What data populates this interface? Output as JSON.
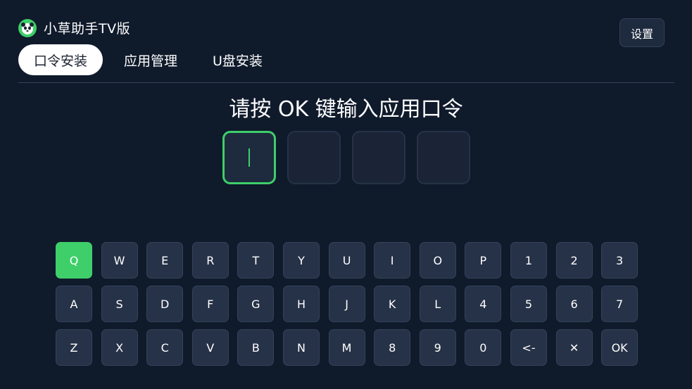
{
  "app": {
    "title": "小草助手TV版",
    "logo_icon": "panda-logo-icon",
    "accent_color": "#3ecf6a"
  },
  "header": {
    "settings_label": "设置"
  },
  "tabs": [
    {
      "label": "口令安装",
      "active": true
    },
    {
      "label": "应用管理",
      "active": false
    },
    {
      "label": "U盘安装",
      "active": false
    }
  ],
  "prompt": "请按 OK 键输入应用口令",
  "code": {
    "length": 4,
    "values": [
      "",
      "",
      "",
      ""
    ],
    "active_index": 0
  },
  "keyboard": {
    "focused_key": "Q",
    "rows": [
      [
        "Q",
        "W",
        "E",
        "R",
        "T",
        "Y",
        "U",
        "I",
        "O",
        "P",
        "1",
        "2",
        "3"
      ],
      [
        "A",
        "S",
        "D",
        "F",
        "G",
        "H",
        "J",
        "K",
        "L",
        "4",
        "5",
        "6",
        "7"
      ],
      [
        "Z",
        "X",
        "C",
        "V",
        "B",
        "N",
        "M",
        "8",
        "9",
        "0",
        "<-",
        "✕",
        "OK"
      ]
    ]
  }
}
